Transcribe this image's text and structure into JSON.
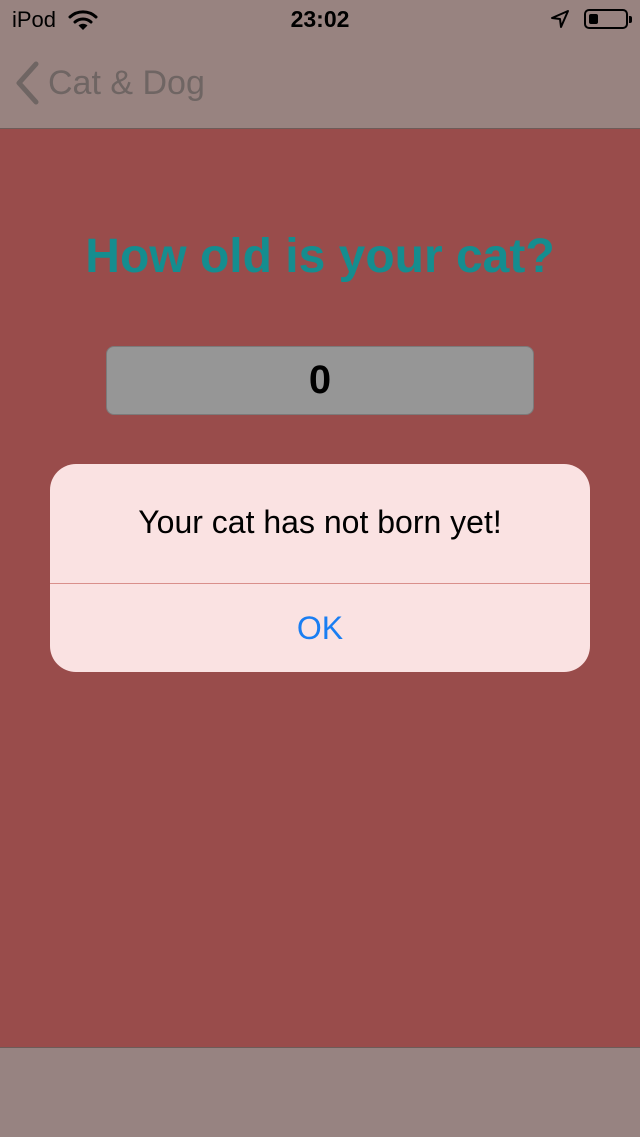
{
  "status_bar": {
    "carrier": "iPod",
    "time": "23:02",
    "battery_level": 0.25,
    "icons": [
      "wifi-icon",
      "location-arrow-icon",
      "battery-icon"
    ]
  },
  "nav": {
    "back_label": "Cat & Dog",
    "back_icon": "chevron-left-icon"
  },
  "main": {
    "question": "How old is your cat?",
    "age_value": "0"
  },
  "alert": {
    "message": "Your cat has not born yet!",
    "ok_label": "OK"
  },
  "colors": {
    "accent": "#158d8f",
    "content_background": "#994c4b",
    "alert_button": "#1a7ef2"
  }
}
